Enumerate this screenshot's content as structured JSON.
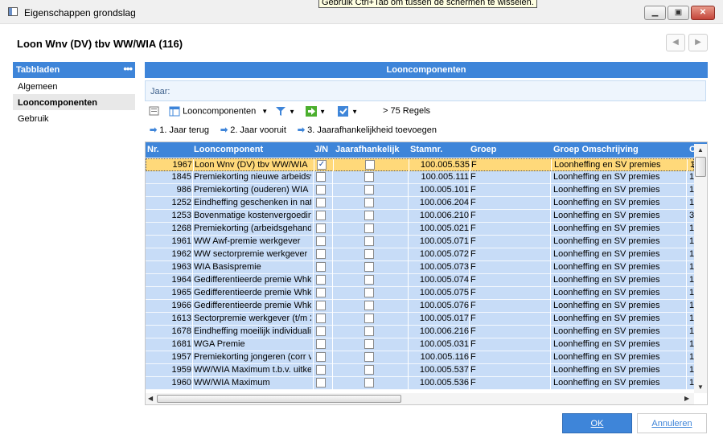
{
  "window": {
    "title": "Eigenschappen grondslag",
    "tooltip": "Gebruik Ctrl+Tab om tussen de schermen te wisselen."
  },
  "header": {
    "entity_title": "Loon Wnv (DV) tbv WW/WIA (116)"
  },
  "sidebar": {
    "title": "Tabbladen",
    "items": [
      {
        "label": "Algemeen"
      },
      {
        "label": "Looncomponenten"
      },
      {
        "label": "Gebruik"
      }
    ]
  },
  "main": {
    "title": "Looncomponenten",
    "filter_label": "Jaar:"
  },
  "toolbar": {
    "view_label": "Looncomponenten",
    "rows_label": "> 75 Regels"
  },
  "actions": [
    {
      "label": "1. Jaar terug"
    },
    {
      "label": "2. Jaar vooruit"
    },
    {
      "label": "3. Jaarafhankelijkheid toevoegen"
    }
  ],
  "grid": {
    "columns": [
      "Nr.",
      "Looncomponent",
      "J/N",
      "Jaarafhankelijk",
      "Stamnr.",
      "Groep",
      "Groep Omschrijving",
      "C"
    ],
    "rows": [
      {
        "nr": "1967",
        "name": "Loon Wnv (DV) tbv WW/WIA",
        "jn": true,
        "jaar": false,
        "stamnr": "100.005.535",
        "groep": "F",
        "oms": "Loonheffing en SV premies",
        "c": "1"
      },
      {
        "nr": "1845",
        "name": "Premiekorting nieuwe arbeidsv",
        "jn": false,
        "jaar": false,
        "stamnr": "100.005.111",
        "groep": "F",
        "oms": "Loonheffing en SV premies",
        "c": "1"
      },
      {
        "nr": "986",
        "name": "Premiekorting (ouderen) WIA",
        "jn": false,
        "jaar": false,
        "stamnr": "100.005.101",
        "groep": "F",
        "oms": "Loonheffing en SV premies",
        "c": "1"
      },
      {
        "nr": "1252",
        "name": "Eindheffing geschenken in nat",
        "jn": false,
        "jaar": false,
        "stamnr": "100.006.204",
        "groep": "F",
        "oms": "Loonheffing en SV premies",
        "c": "1"
      },
      {
        "nr": "1253",
        "name": "Bovenmatige kostenvergoedin",
        "jn": false,
        "jaar": false,
        "stamnr": "100.006.210",
        "groep": "F",
        "oms": "Loonheffing en SV premies",
        "c": "3"
      },
      {
        "nr": "1268",
        "name": "Premiekorting (arbeidsgehandi",
        "jn": false,
        "jaar": false,
        "stamnr": "100.005.021",
        "groep": "F",
        "oms": "Loonheffing en SV premies",
        "c": "1"
      },
      {
        "nr": "1961",
        "name": "WW Awf-premie werkgever",
        "jn": false,
        "jaar": false,
        "stamnr": "100.005.071",
        "groep": "F",
        "oms": "Loonheffing en SV premies",
        "c": "1"
      },
      {
        "nr": "1962",
        "name": "WW sectorpremie werkgever",
        "jn": false,
        "jaar": false,
        "stamnr": "100.005.072",
        "groep": "F",
        "oms": "Loonheffing en SV premies",
        "c": "1"
      },
      {
        "nr": "1963",
        "name": "WIA Basispremie",
        "jn": false,
        "jaar": false,
        "stamnr": "100.005.073",
        "groep": "F",
        "oms": "Loonheffing en SV premies",
        "c": "1"
      },
      {
        "nr": "1964",
        "name": "Gedifferentieerde premie Whk",
        "jn": false,
        "jaar": false,
        "stamnr": "100.005.074",
        "groep": "F",
        "oms": "Loonheffing en SV premies",
        "c": "1"
      },
      {
        "nr": "1965",
        "name": "Gedifferentieerde premie Whk",
        "jn": false,
        "jaar": false,
        "stamnr": "100.005.075",
        "groep": "F",
        "oms": "Loonheffing en SV premies",
        "c": "1"
      },
      {
        "nr": "1966",
        "name": "Gedifferentieerde premie Whk",
        "jn": false,
        "jaar": false,
        "stamnr": "100.005.076",
        "groep": "F",
        "oms": "Loonheffing en SV premies",
        "c": "1"
      },
      {
        "nr": "1613",
        "name": "Sectorpremie werkgever (t/m 2",
        "jn": false,
        "jaar": false,
        "stamnr": "100.005.017",
        "groep": "F",
        "oms": "Loonheffing en SV premies",
        "c": "1"
      },
      {
        "nr": "1678",
        "name": "Eindheffing moeilijk individualis",
        "jn": false,
        "jaar": false,
        "stamnr": "100.006.216",
        "groep": "F",
        "oms": "Loonheffing en SV premies",
        "c": "1"
      },
      {
        "nr": "1681",
        "name": "WGA Premie",
        "jn": false,
        "jaar": false,
        "stamnr": "100.005.031",
        "groep": "F",
        "oms": "Loonheffing en SV premies",
        "c": "1"
      },
      {
        "nr": "1957",
        "name": "Premiekorting jongeren (corr vo",
        "jn": false,
        "jaar": false,
        "stamnr": "100.005.116",
        "groep": "F",
        "oms": "Loonheffing en SV premies",
        "c": "1"
      },
      {
        "nr": "1959",
        "name": "WW/WIA Maximum t.b.v. uitke",
        "jn": false,
        "jaar": false,
        "stamnr": "100.005.537",
        "groep": "F",
        "oms": "Loonheffing en SV premies",
        "c": "1"
      },
      {
        "nr": "1960",
        "name": "WW/WIA Maximum",
        "jn": false,
        "jaar": false,
        "stamnr": "100.005.536",
        "groep": "F",
        "oms": "Loonheffing en SV premies",
        "c": "1"
      }
    ]
  },
  "buttons": {
    "ok": "OK",
    "cancel": "Annuleren"
  },
  "colors": {
    "accent": "#3e85d9",
    "row": "#c7dcf7",
    "selected_row": "#ffd97a"
  }
}
